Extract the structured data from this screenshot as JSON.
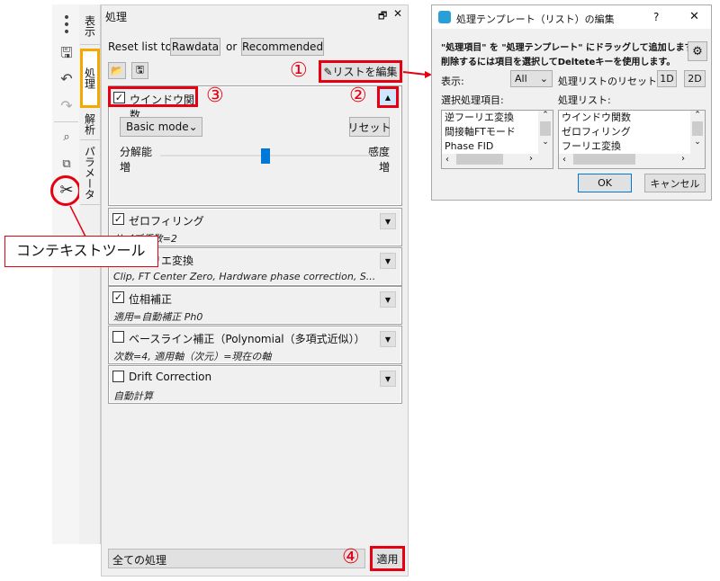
{
  "toolbar": {
    "icons": [
      "more-icon",
      "save-icon",
      "undo-icon",
      "redo-icon",
      "search-icon",
      "zoom-icon",
      "tools-icon"
    ]
  },
  "tabs": [
    "表示",
    "処理",
    "解析",
    "パラメータ"
  ],
  "panel": {
    "title": "処理",
    "reset_label": "Reset list to",
    "rawdata": "Rawdata",
    "or": "or",
    "recommended": "Recommended",
    "edit_list": "リストを編集",
    "window": {
      "title": "ウインドウ関数",
      "checked": true,
      "mode": "Basic mode",
      "reset": "リセット",
      "left_label": "分解能",
      "left_label2": "増",
      "right_label": "感度",
      "right_label2": "増",
      "slider_value": 0.5
    },
    "sections": [
      {
        "title": "ゼロフィリング",
        "sub": "サイズ係数=2",
        "checked": true
      },
      {
        "title": "フーリエ変換",
        "sub": "Clip, FT Center Zero, Hardware phase correction, S...",
        "checked": true
      },
      {
        "title": "位相補正",
        "sub": "適用=自動補正 Ph0",
        "checked": true
      },
      {
        "title": "ベースライン補正（Polynomial（多項式近似））",
        "sub": "次数=4, 適用軸（次元）=現在の軸",
        "checked": false
      },
      {
        "title": "Drift Correction",
        "sub": "自動計算",
        "checked": false
      }
    ],
    "scope": "全ての処理",
    "apply": "適用"
  },
  "annotations": {
    "n1": "①",
    "n2": "②",
    "n3": "③",
    "n4": "④",
    "callout": "コンテキストツール",
    "accent": "#e60012"
  },
  "dialog": {
    "title": "処理テンプレート（リスト）の編集",
    "help": "?",
    "close": "✕",
    "line1": "\"処理項目\" を \"処理テンプレート\" にドラッグして追加します。",
    "line2": "削除するには項目を選択してDelteteキーを使用します。",
    "show_label": "表示:",
    "show_value": "All",
    "reset_label": "処理リストのリセット:",
    "b1d": "1D",
    "b2d": "2D",
    "left_label": "選択処理項目:",
    "right_label": "処理リスト:",
    "left_items": [
      "逆フーリエ変換",
      "間接軸FTモード",
      "Phase FID"
    ],
    "right_items": [
      "ウインドウ関数",
      "ゼロフィリング",
      "フーリエ変換"
    ],
    "ok": "OK",
    "cancel": "キャンセル"
  }
}
